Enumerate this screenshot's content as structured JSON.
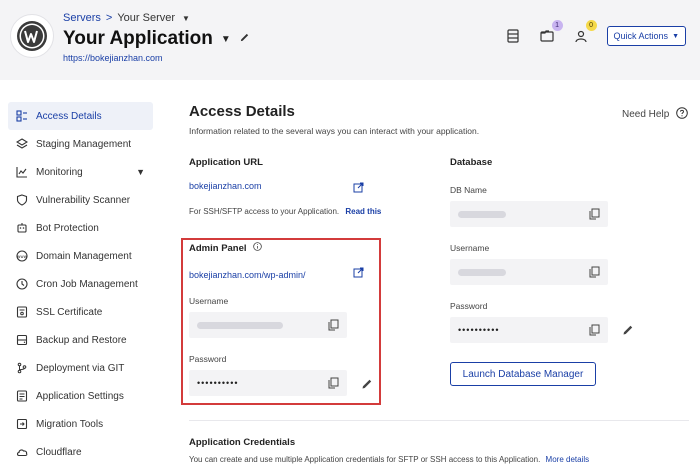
{
  "header": {
    "breadcrumb_servers": "Servers",
    "breadcrumb_separator": ">",
    "breadcrumb_server": "Your Server",
    "app_title": "Your Application",
    "app_url": "https://bokejianzhan.com",
    "notifications_count": "1",
    "user_badge_count": "0",
    "quick_actions_label": "Quick Actions"
  },
  "sidebar": {
    "items": [
      {
        "label": "Access Details",
        "icon": "access-details-icon",
        "active": true
      },
      {
        "label": "Staging Management",
        "icon": "layers-icon"
      },
      {
        "label": "Monitoring",
        "icon": "chart-line-icon",
        "expandable": true
      },
      {
        "label": "Vulnerability Scanner",
        "icon": "shield-icon"
      },
      {
        "label": "Bot Protection",
        "icon": "bot-icon"
      },
      {
        "label": "Domain Management",
        "icon": "www-icon"
      },
      {
        "label": "Cron Job Management",
        "icon": "clock-icon"
      },
      {
        "label": "SSL Certificate",
        "icon": "certificate-icon"
      },
      {
        "label": "Backup and Restore",
        "icon": "backup-icon"
      },
      {
        "label": "Deployment via GIT",
        "icon": "git-icon"
      },
      {
        "label": "Application Settings",
        "icon": "settings-icon"
      },
      {
        "label": "Migration Tools",
        "icon": "migration-icon"
      },
      {
        "label": "Cloudflare",
        "icon": "cloud-icon"
      }
    ]
  },
  "main": {
    "title": "Access Details",
    "description": "Information related to the several ways you can interact with your application.",
    "need_help": "Need Help",
    "application_url": {
      "heading": "Application URL",
      "url": "bokejianzhan.com",
      "note": "For SSH/SFTP access to your Application.",
      "read_more": "Read this"
    },
    "admin_panel": {
      "heading": "Admin Panel",
      "url": "bokejianzhan.com/wp-admin/",
      "username_label": "Username",
      "password_label": "Password",
      "password_value": "••••••••••"
    },
    "database": {
      "heading": "Database",
      "db_name_label": "DB Name",
      "username_label": "Username",
      "password_label": "Password",
      "password_value": "••••••••••",
      "launch_button": "Launch Database Manager"
    },
    "credentials": {
      "heading": "Application Credentials",
      "description": "You can create and use multiple Application credentials for SFTP or SSH access to this Application.",
      "more_details": "More details"
    }
  },
  "colors": {
    "accent": "#1a3fa6",
    "highlight_border": "#d33b3b",
    "header_bg": "#f4f4f6"
  }
}
